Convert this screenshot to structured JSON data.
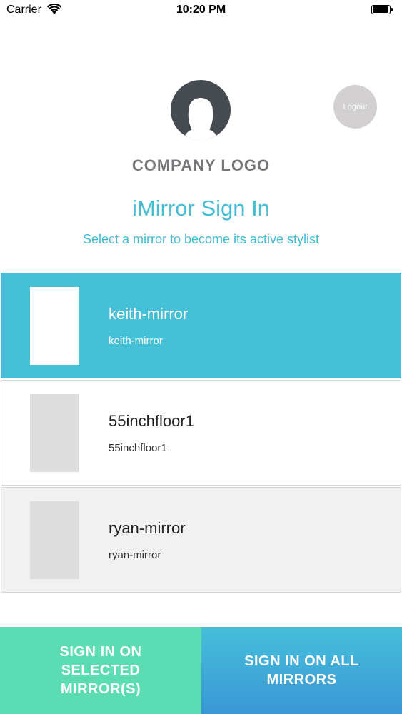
{
  "status_bar": {
    "carrier": "Carrier",
    "time": "10:20 PM",
    "icons": [
      "wifi-icon",
      "battery-icon"
    ]
  },
  "header": {
    "avatar_icon": "user-silhouette-icon",
    "logout_label": "Logout",
    "company_logo": "COMPANY LOGO",
    "title": "iMirror Sign In",
    "subtitle": "Select a mirror to become its active stylist"
  },
  "mirrors": [
    {
      "name": "keith-mirror",
      "subname": "keith-mirror",
      "state": "selected"
    },
    {
      "name": "55inchfloor1",
      "subname": "55inchfloor1",
      "state": "unselected"
    },
    {
      "name": "ryan-mirror",
      "subname": "ryan-mirror",
      "state": "unselected"
    }
  ],
  "actions": {
    "sign_in_selected": "SIGN IN ON SELECTED MIRROR(S)",
    "sign_in_all": "SIGN IN ON ALL MIRRORS"
  },
  "colors": {
    "accent": "#45bcd3",
    "selected_row": "#45c0d6",
    "button_green": "#5bdcb3",
    "button_blue_top": "#46bfd9",
    "button_blue_bottom": "#3a97d6",
    "logo_gray": "#76777a",
    "avatar": "#464b52"
  }
}
